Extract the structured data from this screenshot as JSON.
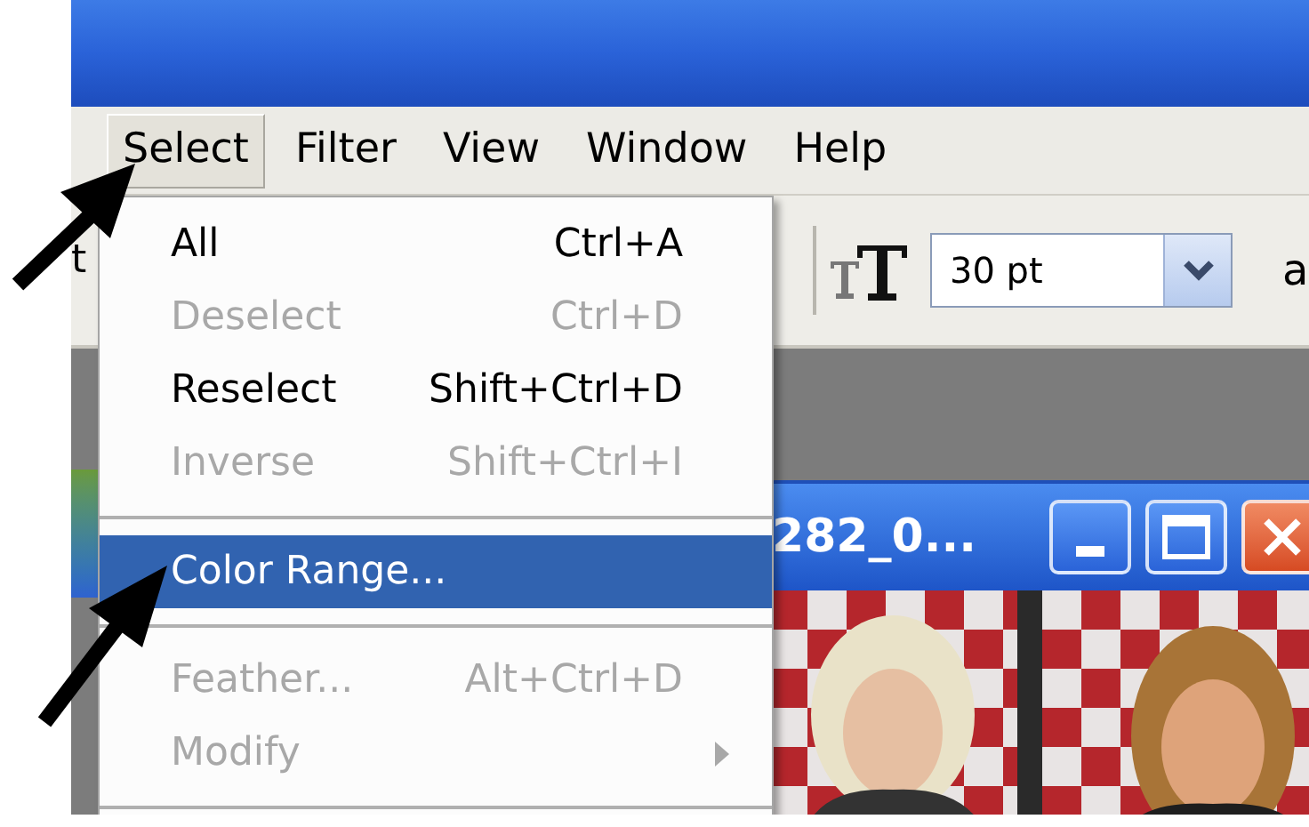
{
  "menu_bar": [
    {
      "label": "Select",
      "selected": true
    },
    {
      "label": "Filter",
      "selected": false
    },
    {
      "label": "View",
      "selected": false
    },
    {
      "label": "Window",
      "selected": false
    },
    {
      "label": "Help",
      "selected": false
    }
  ],
  "dropdown": [
    {
      "kind": "item",
      "label": "All",
      "shortcut": "Ctrl+A",
      "disabled": false,
      "selected": false
    },
    {
      "kind": "item",
      "label": "Deselect",
      "shortcut": "Ctrl+D",
      "disabled": true,
      "selected": false
    },
    {
      "kind": "item",
      "label": "Reselect",
      "shortcut": "Shift+Ctrl+D",
      "disabled": false,
      "selected": false
    },
    {
      "kind": "item",
      "label": "Inverse",
      "shortcut": "Shift+Ctrl+I",
      "disabled": true,
      "selected": false
    },
    {
      "kind": "separator"
    },
    {
      "kind": "item",
      "label": "Color Range...",
      "disabled": false,
      "selected": true
    },
    {
      "kind": "separator"
    },
    {
      "kind": "item",
      "label": "Feather...",
      "shortcut": "Alt+Ctrl+D",
      "disabled": true,
      "selected": false
    },
    {
      "kind": "submenu",
      "label": "Modify",
      "disabled": true,
      "selected": false
    },
    {
      "kind": "separator"
    }
  ],
  "toolbar": {
    "cut_text": "t",
    "font_size": "30 pt",
    "trailing_text": "a"
  },
  "document": {
    "title": "282_0..."
  }
}
